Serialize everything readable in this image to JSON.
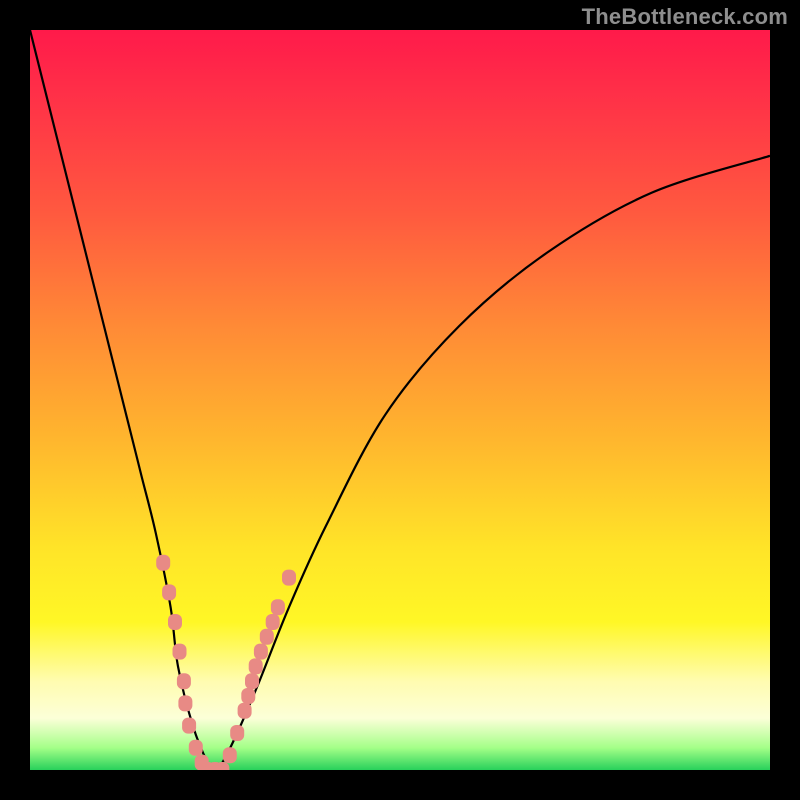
{
  "watermark": "TheBottleneck.com",
  "chart_data": {
    "type": "line",
    "title": "",
    "xlabel": "",
    "ylabel": "",
    "xlim": [
      0,
      100
    ],
    "ylim": [
      0,
      100
    ],
    "grid": false,
    "legend": false,
    "series": [
      {
        "name": "bottleneck-curve",
        "x": [
          0,
          4,
          7,
          10,
          13,
          15,
          17,
          19,
          20,
          22,
          24,
          25,
          26,
          28,
          31,
          35,
          40,
          48,
          58,
          70,
          84,
          100
        ],
        "y": [
          100,
          84,
          72,
          60,
          48,
          40,
          32,
          22,
          14,
          6,
          1,
          0,
          1,
          5,
          12,
          22,
          33,
          48,
          60,
          70,
          78,
          83
        ]
      }
    ],
    "markers": {
      "name": "highlighted-values",
      "color": "#e88a85",
      "points": [
        {
          "x": 18.0,
          "y": 28
        },
        {
          "x": 18.8,
          "y": 24
        },
        {
          "x": 19.6,
          "y": 20
        },
        {
          "x": 20.2,
          "y": 16
        },
        {
          "x": 20.8,
          "y": 12
        },
        {
          "x": 21.0,
          "y": 9
        },
        {
          "x": 21.5,
          "y": 6
        },
        {
          "x": 22.4,
          "y": 3
        },
        {
          "x": 23.2,
          "y": 1
        },
        {
          "x": 24.0,
          "y": 0
        },
        {
          "x": 25.0,
          "y": 0
        },
        {
          "x": 26.0,
          "y": 0
        },
        {
          "x": 27.0,
          "y": 2
        },
        {
          "x": 28.0,
          "y": 5
        },
        {
          "x": 29.0,
          "y": 8
        },
        {
          "x": 29.5,
          "y": 10
        },
        {
          "x": 30.0,
          "y": 12
        },
        {
          "x": 30.5,
          "y": 14
        },
        {
          "x": 31.2,
          "y": 16
        },
        {
          "x": 32.0,
          "y": 18
        },
        {
          "x": 32.8,
          "y": 20
        },
        {
          "x": 33.5,
          "y": 22
        },
        {
          "x": 35.0,
          "y": 26
        }
      ]
    }
  }
}
